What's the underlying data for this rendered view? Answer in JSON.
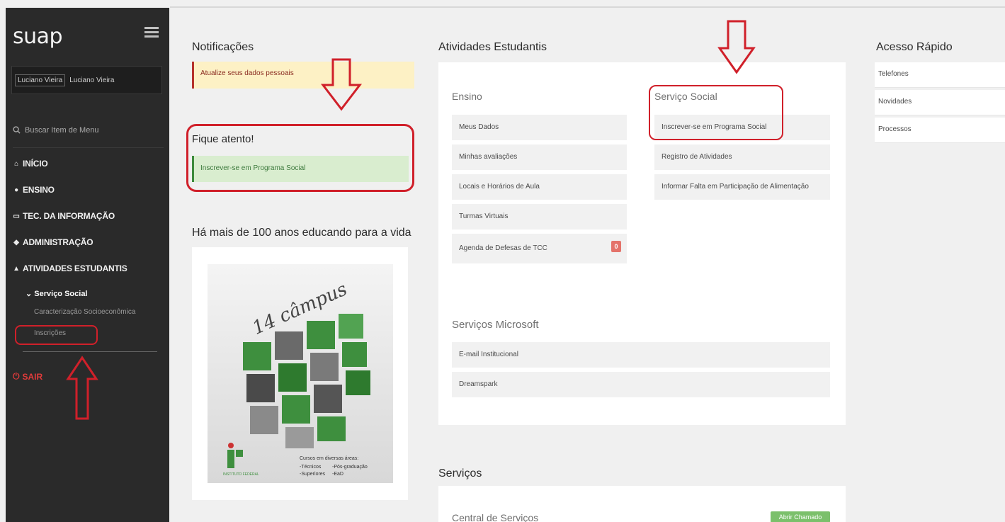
{
  "sidebar": {
    "brand": "suap",
    "user_img_alt": "Luciano Vieira",
    "user_name": "Luciano Vieira",
    "search_label": "Buscar Item de Menu",
    "nav": {
      "inicio": "INÍCIO",
      "ensino": "ENSINO",
      "tec": "TEC. DA INFORMAÇÃO",
      "admin": "ADMINISTRAÇÃO",
      "atividades": "ATIVIDADES ESTUDANTIS"
    },
    "servico_social": "Serviço Social",
    "sub_items": [
      "Caracterização Socioeconômica",
      "Inscrições"
    ],
    "sair": "SAIR"
  },
  "notificacoes": {
    "title": "Notificações",
    "item": "Atualize seus dados pessoais"
  },
  "fique_atento": {
    "title": "Fique atento!",
    "item": "Inscrever-se em Programa Social"
  },
  "banner": {
    "title": "Há mais de 100 anos educando para a vida",
    "campus_text": "14 câmpus",
    "cursos_title": "Cursos em diversas áreas:",
    "cursos_col1": [
      "-Técnicos",
      "-Superiores"
    ],
    "cursos_col2": [
      "-Pós-graduação",
      "-EaD"
    ],
    "logo_text": "INSTITUTO FEDERAL"
  },
  "atividades": {
    "title": "Atividades Estudantis",
    "ensino": {
      "head": "Ensino",
      "items": [
        "Meus Dados",
        "Minhas avaliações",
        "Locais e Horários de Aula",
        "Turmas Virtuais",
        "Agenda de Defesas de TCC"
      ],
      "badge": "0"
    },
    "servico_social": {
      "head": "Serviço Social",
      "items": [
        "Inscrever-se em Programa Social",
        "Registro de Atividades",
        "Informar Falta em Participação de Alimentação"
      ]
    },
    "microsoft": {
      "head": "Serviços Microsoft",
      "items": [
        "E-mail Institucional",
        "Dreamspark"
      ]
    }
  },
  "servicos": {
    "title": "Serviços",
    "central": "Central de Serviços",
    "button": "Abrir Chamado"
  },
  "acesso_rapido": {
    "title": "Acesso Rápido",
    "items": [
      "Telefones",
      "Novidades",
      "Processos"
    ]
  },
  "colors": {
    "sidebar_bg": "#2a2a2a",
    "accent_red": "#d0202a",
    "green_alert": "#d9edcf",
    "yellow_alert": "#fdf1c5",
    "button_green": "#7bc06b"
  }
}
